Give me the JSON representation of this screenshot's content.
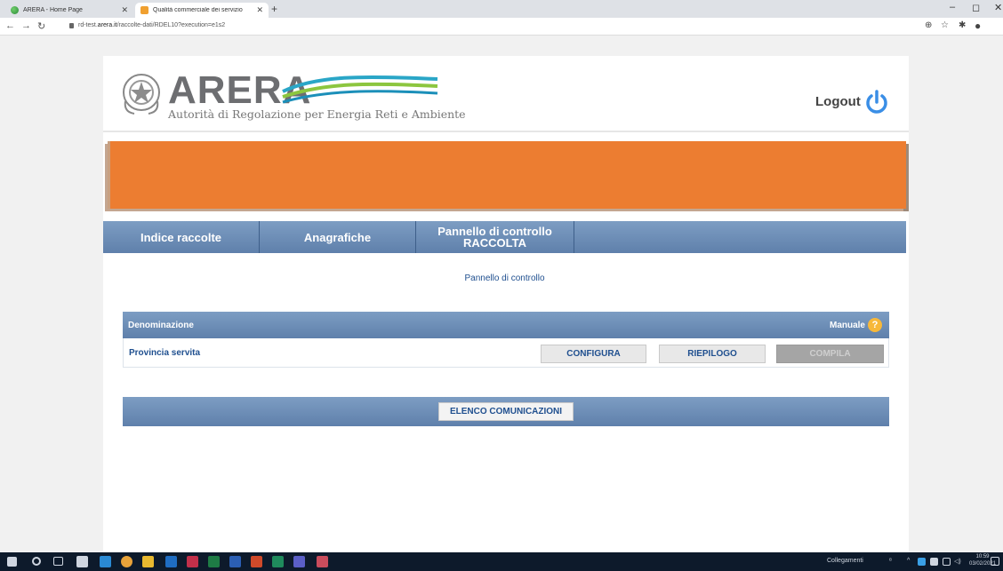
{
  "browser": {
    "tabs": [
      {
        "label": "ARERA - Home Page",
        "active": false
      },
      {
        "label": "Qualità commerciale dei servizio",
        "active": true
      }
    ],
    "new_tab": "+",
    "url_prefix": "rd-test.",
    "url_host": "arera.it",
    "url_path": "/raccolte-dati/RDEL10?execution=e1s2"
  },
  "header": {
    "logo_text": "ARERA",
    "logo_subtitle": "Autorità di Regolazione per Energia Reti e Ambiente",
    "logout_label": "Logout"
  },
  "menu": {
    "items": [
      {
        "label": "Indice raccolte"
      },
      {
        "label": "Anagrafiche"
      },
      {
        "label_line1": "Pannello di controllo",
        "label_line2": "RACCOLTA"
      }
    ]
  },
  "main": {
    "title": "Pannello di controllo",
    "table": {
      "col_header": "Denominazione",
      "manual_label": "Manuale",
      "help_glyph": "?",
      "rows": [
        {
          "name": "Provincia servita",
          "buttons": [
            "CONFIGURA",
            "RIEPILOGO",
            "COMPILA"
          ]
        }
      ]
    },
    "bottom_button": "ELENCO COMUNICAZIONI"
  },
  "taskbar": {
    "network_label": "Collegamenti",
    "time": "10:59",
    "date": "03/02/2021"
  },
  "colors": {
    "banner": "#ec7d31",
    "menu_bar": "#6b8cb6",
    "link_blue": "#1f4f8f",
    "power_icon": "#3a8ee6",
    "help_icon": "#f7b83a"
  }
}
